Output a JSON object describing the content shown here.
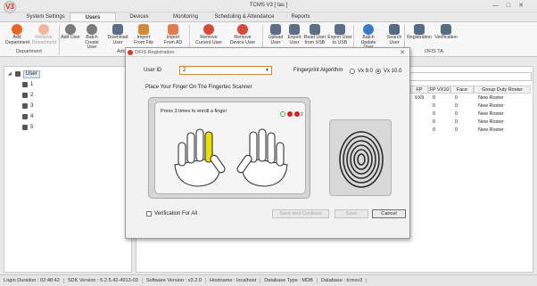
{
  "window": {
    "title": "TCMS V3 [ tas ]",
    "logo": "V3",
    "controls": [
      "—",
      "□",
      "✕"
    ]
  },
  "tabs": [
    {
      "label": "System Settings",
      "active": false
    },
    {
      "label": "Users",
      "active": true
    },
    {
      "label": "Devices",
      "active": false
    },
    {
      "label": "Monitoring",
      "active": false
    },
    {
      "label": "Scheduling & Attendance",
      "active": false
    },
    {
      "label": "Reports",
      "active": false
    }
  ],
  "ribbon": {
    "buttons": [
      {
        "label": "Add Department",
        "icon": "add-circle-icon",
        "enabled": true
      },
      {
        "label": "Remove Department",
        "icon": "remove-circle-icon",
        "enabled": false
      },
      {
        "label": "Add User",
        "icon": "add-user-icon",
        "enabled": true
      },
      {
        "label": "Batch Create User",
        "icon": "batch-create-icon",
        "enabled": true
      },
      {
        "label": "Download User",
        "icon": "download-icon",
        "enabled": true
      },
      {
        "label": "Import From File",
        "icon": "import-file-icon",
        "enabled": true
      },
      {
        "label": "Import From AD",
        "icon": "import-ad-icon",
        "enabled": true
      },
      {
        "label": "Remove Current User",
        "icon": "remove-user-icon",
        "enabled": true
      },
      {
        "label": "Remove Device User",
        "icon": "remove-device-user-icon",
        "enabled": true
      },
      {
        "label": "Upload User",
        "icon": "upload-icon",
        "enabled": true
      },
      {
        "label": "Export User",
        "icon": "export-icon",
        "enabled": true
      },
      {
        "label": "Read User from USB",
        "icon": "read-usb-icon",
        "enabled": true
      },
      {
        "label": "Export User to USB",
        "icon": "export-usb-icon",
        "enabled": true
      },
      {
        "label": "Batch Update User",
        "icon": "batch-update-icon",
        "enabled": true
      },
      {
        "label": "Search User",
        "icon": "search-user-icon",
        "enabled": true
      },
      {
        "label": "Registration",
        "icon": "registration-icon",
        "enabled": true
      },
      {
        "label": "Verification",
        "icon": "verification-icon",
        "enabled": true
      }
    ],
    "groups": [
      "Department",
      "Add",
      "OFIS TA"
    ]
  },
  "tree": {
    "root": "User",
    "items": [
      "1",
      "2",
      "3",
      "4",
      "5"
    ]
  },
  "grid": {
    "columns": [
      "FP VX9",
      "FP VX10",
      "Face",
      "Group Duty Roster"
    ],
    "rows": [
      [
        "0",
        "0",
        "New Roster"
      ],
      [
        "0",
        "0",
        "New Roster"
      ],
      [
        "0",
        "0",
        "New Roster"
      ],
      [
        "0",
        "0",
        "New Roster"
      ],
      [
        "0",
        "0",
        "New Roster"
      ]
    ]
  },
  "dialog": {
    "title": "OFIS Registration",
    "user_id_label": "User ID",
    "user_id_value": "2",
    "algorithm_label": "Fingerprint Algorithm",
    "algorithm_options": [
      "Vx 9.0",
      "Vx 10.0"
    ],
    "algorithm_selected": "Vx 10.0",
    "instruction": "Place Your Finger On The Fingertec Scanner",
    "enroll_prompt": "Press 3 times to enroll a finger",
    "enroll_count": "2",
    "verification_label": "Verification For All",
    "buttons": {
      "save_continue": "Save and Continue",
      "save": "Save",
      "cancel": "Cancel"
    },
    "colors": {
      "highlight_finger": "#e8e000",
      "dot_green": "#43b049",
      "dot_red": "#d32222"
    }
  },
  "status": [
    "Login Duration : 02:48:42",
    "SDK Version : 6.2.5.42-4913-03",
    "Software Version : v3.2.0",
    "Hostname : localhost",
    "Database Type : MDB",
    "Database : tcmsv3"
  ]
}
